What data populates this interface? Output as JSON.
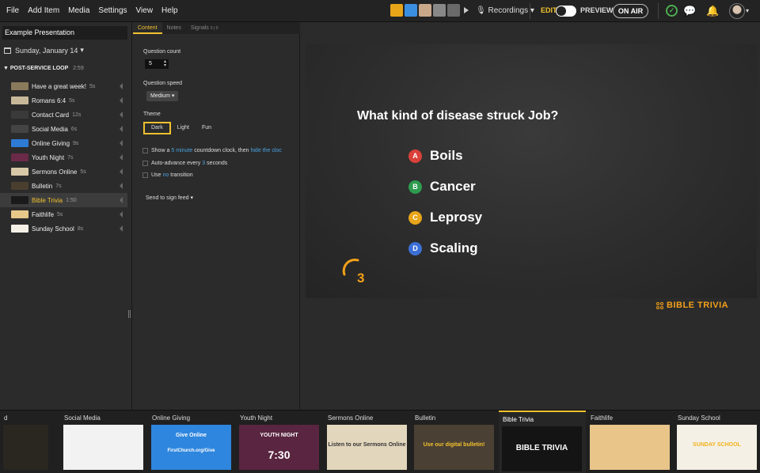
{
  "menu": [
    "File",
    "Add Item",
    "Media",
    "Settings",
    "View",
    "Help"
  ],
  "topbar": {
    "recordings_label": "Recordings",
    "edit_label": "EDIT",
    "preview_label": "PREVIEW",
    "on_air_label": "ON AIR",
    "icons": [
      "microphone-icon",
      "chat-icon",
      "bell-icon",
      "check-icon",
      "avatar"
    ]
  },
  "sidebar": {
    "presentation_title": "Example Presentation",
    "date": "Sunday, January 14",
    "loop_title": "POST-SERVICE LOOP",
    "loop_duration": "2:59",
    "items": [
      {
        "name": "Have a great week!",
        "duration": "5s",
        "color": "#8a7a5c"
      },
      {
        "name": "Romans 6:4",
        "duration": "5s",
        "color": "#c8b89a"
      },
      {
        "name": "Contact Card",
        "duration": "12s",
        "color": "#3a3a3a"
      },
      {
        "name": "Social Media",
        "duration": "6s",
        "color": "#444444"
      },
      {
        "name": "Online Giving",
        "duration": "9s",
        "color": "#2e7bd6"
      },
      {
        "name": "Youth Night",
        "duration": "7s",
        "color": "#6a2a48"
      },
      {
        "name": "Sermons Online",
        "duration": "5s",
        "color": "#d7c9a8"
      },
      {
        "name": "Bulletin",
        "duration": "7s",
        "color": "#4a3f2f"
      },
      {
        "name": "Bible Trivia",
        "duration": "1:50",
        "color": "#1a1a1a"
      },
      {
        "name": "Faithlife",
        "duration": "5s",
        "color": "#e8c98a"
      },
      {
        "name": "Sunday School",
        "duration": "8s",
        "color": "#f4f0e6"
      }
    ],
    "active_index": 8
  },
  "tabs": {
    "content": "Content",
    "notes": "Notes",
    "signals": "Signals",
    "signals_sub": "0 | 0"
  },
  "settings": {
    "question_count_label": "Question count",
    "question_count_value": "5",
    "question_speed_label": "Question speed",
    "question_speed_value": "Medium",
    "theme_label": "Theme",
    "themes": [
      "Dark",
      "Light",
      "Fun"
    ],
    "selected_theme": "Dark",
    "countdown_pre": "Show a",
    "countdown_minutes": "5 minute",
    "countdown_mid": "countdown clock, then",
    "countdown_link": "hide the cloc",
    "autoadvance_pre": "Auto-advance every",
    "autoadvance_num": "3",
    "autoadvance_post": "seconds",
    "transition_pre": "Use",
    "transition_link": "no",
    "transition_post": "transition",
    "send_to_feed": "Send to sign feed"
  },
  "slide": {
    "question": "What kind of disease struck Job?",
    "answers": [
      {
        "letter": "A",
        "text": "Boils",
        "color": "#d9413a"
      },
      {
        "letter": "B",
        "text": "Cancer",
        "color": "#2e9b4f"
      },
      {
        "letter": "C",
        "text": "Leprosy",
        "color": "#e8a51a"
      },
      {
        "letter": "D",
        "text": "Scaling",
        "color": "#3b6fd6"
      }
    ],
    "timer_value": "3",
    "brand": "BIBLE TRIVIA"
  },
  "strip": [
    {
      "caption": "d",
      "bg": "#2a2620"
    },
    {
      "caption": "Social Media",
      "bg": "#f2f2f2"
    },
    {
      "caption": "Online Giving",
      "bg": "#2e86de",
      "line1": "Give Online",
      "line2": "FirstChurch.org/Give"
    },
    {
      "caption": "Youth Night",
      "bg": "#5a2540",
      "line1": "YOUTH NIGHT",
      "line2": "7:30"
    },
    {
      "caption": "Sermons Online",
      "bg": "#e2d6bc",
      "line1": "Listen to our Sermons Online"
    },
    {
      "caption": "Bulletin",
      "bg": "#4a4034",
      "line1": "Use our digital bulletin!"
    },
    {
      "caption": "Bible Trivia",
      "bg": "#141414",
      "line1": "BIBLE TRIVIA"
    },
    {
      "caption": "Faithlife",
      "bg": "#e9c58a"
    },
    {
      "caption": "Sunday School",
      "bg": "#f4f0e6",
      "line1": "SUNDAY SCHOOL"
    }
  ],
  "strip_active_index": 6
}
